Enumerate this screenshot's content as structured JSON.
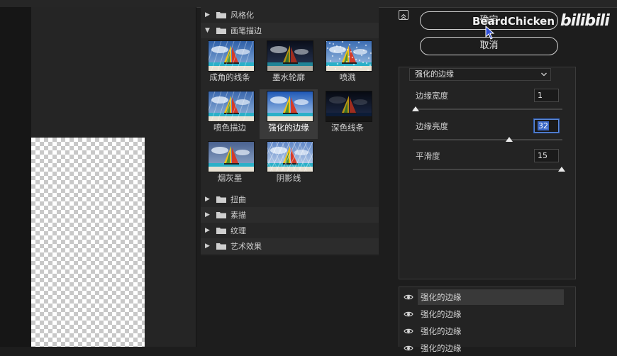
{
  "gallery": {
    "folders_top": [
      {
        "label": "风格化",
        "expanded": false
      },
      {
        "label": "画笔描边",
        "expanded": true
      }
    ],
    "thumbnails": [
      {
        "label": "成角的线条",
        "variant": "angled"
      },
      {
        "label": "墨水轮廓",
        "variant": "ink"
      },
      {
        "label": "喷溅",
        "variant": "spatter"
      },
      {
        "label": "喷色描边",
        "variant": "sprayed"
      },
      {
        "label": "强化的边缘",
        "variant": "accented",
        "selected": true
      },
      {
        "label": "深色线条",
        "variant": "dark"
      },
      {
        "label": "烟灰墨",
        "variant": "sumi"
      },
      {
        "label": "阴影线",
        "variant": "cross"
      }
    ],
    "folders_bottom": [
      {
        "label": "扭曲"
      },
      {
        "label": "素描"
      },
      {
        "label": "纹理"
      },
      {
        "label": "艺术效果"
      }
    ]
  },
  "buttons": {
    "ok_label": "确定",
    "cancel_label": "取消"
  },
  "filter_select": {
    "value": "强化的边缘"
  },
  "params": [
    {
      "label": "边缘宽度",
      "value": "1",
      "fraction": 0.0,
      "focused": false
    },
    {
      "label": "边缘亮度",
      "value": "32",
      "fraction": 0.64,
      "focused": true
    },
    {
      "label": "平滑度",
      "value": "15",
      "fraction": 1.0,
      "focused": false
    }
  ],
  "layers": [
    {
      "name": "强化的边缘",
      "active": true
    },
    {
      "name": "强化的边缘",
      "active": false
    },
    {
      "name": "强化的边缘",
      "active": false
    },
    {
      "name": "强化的边缘",
      "active": false
    }
  ],
  "watermark": {
    "text": "BeardChicken",
    "logo": "bilibili"
  },
  "colors": {
    "panel_bg": "#262626",
    "selection": "#3a3a3a",
    "focus_blue": "#3b68c8"
  }
}
